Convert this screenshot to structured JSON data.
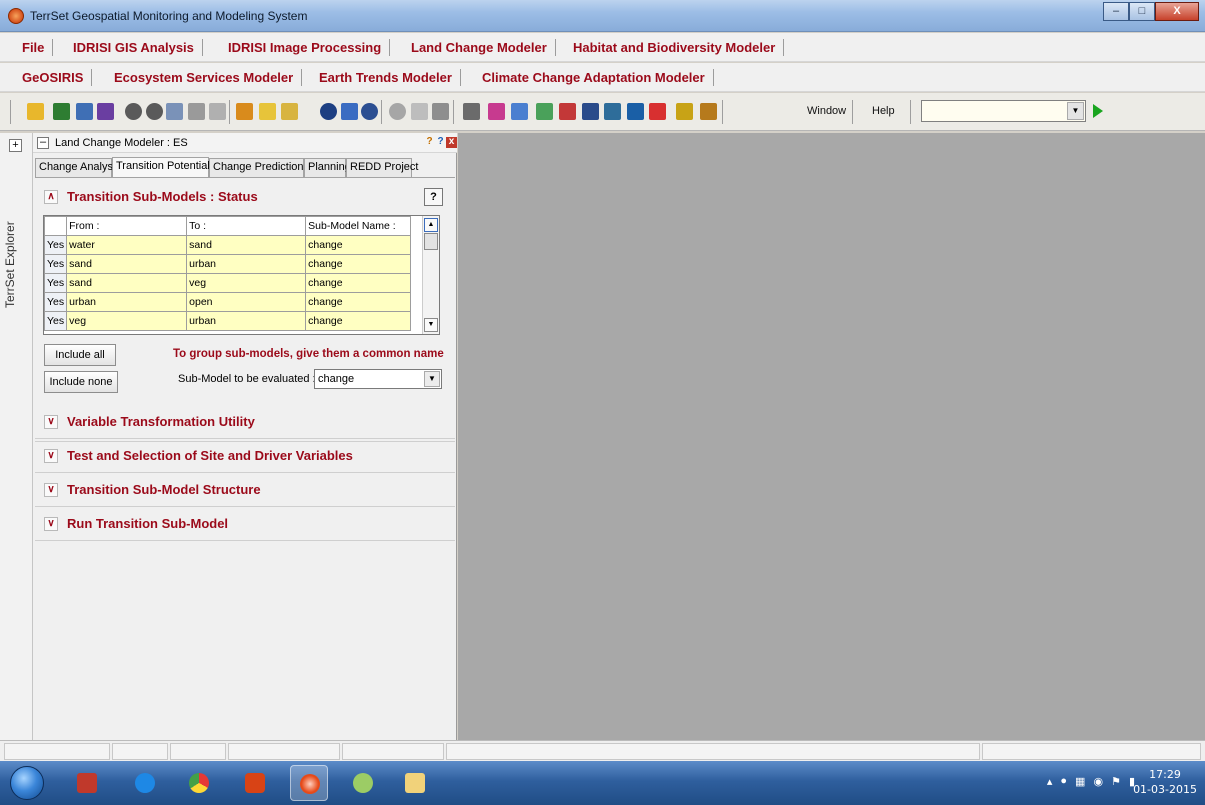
{
  "window": {
    "title": "TerrSet Geospatial Monitoring and Modeling System"
  },
  "menu_row1": [
    "File",
    "IDRISI GIS Analysis",
    "IDRISI Image Processing",
    "Land Change Modeler",
    "Habitat and Biodiversity Modeler"
  ],
  "menu_row2": [
    "GeOSIRIS",
    "Ecosystem Services Modeler",
    "Earth Trends Modeler",
    "Climate Change Adaptation Modeler"
  ],
  "toolbar": {
    "window_label": "Window",
    "help_label": "Help",
    "combo_value": ""
  },
  "explorer": {
    "label": "TerrSet Explorer"
  },
  "panel": {
    "title": "Land Change Modeler : ES",
    "tabs": [
      "Change Analysis",
      "Transition Potentials",
      "Change Prediction",
      "Planning",
      "REDD Project"
    ],
    "active_tab": "Transition Potentials",
    "status_section": {
      "title": "Transition Sub-Models : Status",
      "help_label": "?",
      "columns": [
        "From :",
        "To :",
        "Sub-Model Name :"
      ],
      "rows": [
        {
          "include": "Yes",
          "from": "water",
          "to": "sand",
          "name": "change"
        },
        {
          "include": "Yes",
          "from": "sand",
          "to": "urban",
          "name": "change"
        },
        {
          "include": "Yes",
          "from": "sand",
          "to": "veg",
          "name": "change"
        },
        {
          "include": "Yes",
          "from": "urban",
          "to": "open",
          "name": "change"
        },
        {
          "include": "Yes",
          "from": "veg",
          "to": "urban",
          "name": "change"
        }
      ],
      "include_all": "Include all",
      "include_none": "Include none",
      "hint": "To group sub-models, give them a common name",
      "eval_label": "Sub-Model to be evaluated :",
      "eval_value": "change"
    },
    "collapsed_sections": [
      "Variable Transformation Utility",
      "Test and Selection of Site and Driver Variables",
      "Transition Sub-Model Structure",
      "Run Transition Sub-Model"
    ]
  },
  "taskbar": {
    "time": "17:29",
    "date": "01-03-2015"
  }
}
